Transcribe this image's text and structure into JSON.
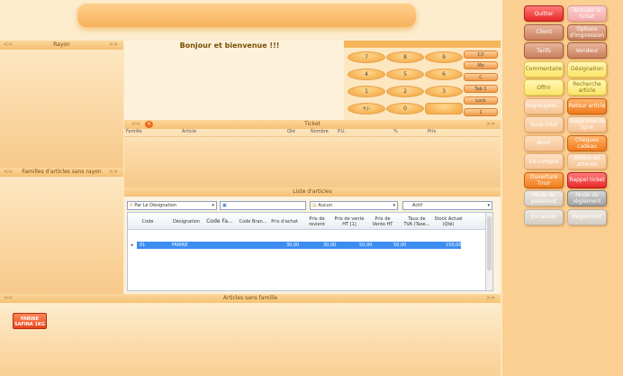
{
  "welcome": "Bonjour et bienvenue !!!",
  "panels": {
    "rayon": "Rayon",
    "familles": "Familles d'articles sans rayon",
    "ticket": "Ticket",
    "liste": "Liste d'articles",
    "articles_sans_famille": "Articles sans famille"
  },
  "nav": {
    "left": "<<",
    "right": ">>"
  },
  "keypad": {
    "rows": [
      [
        "7",
        "8",
        "9"
      ],
      [
        "4",
        "5",
        "6"
      ],
      [
        "1",
        "2",
        "3"
      ],
      [
        "+/-",
        "0",
        ""
      ]
    ],
    "side": [
      "C/I",
      "Mx",
      "C",
      "Tab 1",
      "Lock",
      "1"
    ]
  },
  "ticket_columns": [
    "Famille",
    "Article",
    "Qté",
    "Nombre",
    "P.U.",
    "%",
    "Prix"
  ],
  "search": {
    "filter_value": "Par Le Désignation",
    "search_value": "",
    "scope_value": "Aucun",
    "mode_value": "Actif"
  },
  "grid": {
    "columns": [
      "Code",
      "Désignation",
      "Code Fa...",
      "Code Bran...",
      "Prix d'achat",
      "Prix de revient",
      "Prix de vente HT [1]",
      "Prix de Vente HT",
      "Taux de TVA (Taxe...",
      "Stock Actuel (Qté)"
    ],
    "rows": [
      [
        "01",
        "FARINE",
        "",
        "",
        "30,00",
        "30,00",
        "50,00",
        "50,00",
        "",
        "150,00"
      ]
    ]
  },
  "article_chip": "FARINE SAFINA 1KG",
  "right_buttons": [
    {
      "label": "Quitter",
      "color": "red"
    },
    {
      "label": "Annuler le ticket",
      "color": "pink"
    },
    {
      "label": "Client",
      "color": "brown"
    },
    {
      "label": "Options d'impression",
      "color": "brown"
    },
    {
      "label": "Tarifs",
      "color": "brown"
    },
    {
      "label": "Vendeur",
      "color": "brown"
    },
    {
      "label": "Commentaire",
      "color": "yellow"
    },
    {
      "label": "Désignation",
      "color": "yellow"
    },
    {
      "label": "Offrir",
      "color": "yellow"
    },
    {
      "label": "Recherche article",
      "color": "yellow"
    },
    {
      "label": "Regroupem...",
      "color": "peach"
    },
    {
      "label": "Retour article",
      "color": "orange"
    },
    {
      "label": "Sous-total",
      "color": "peach"
    },
    {
      "label": "Supprimer la ligne",
      "color": "peach"
    },
    {
      "label": "Avoir",
      "color": "peach"
    },
    {
      "label": "Chèques cadeau",
      "color": "orange"
    },
    {
      "label": "En compte",
      "color": "peach"
    },
    {
      "label": "Mettre en attente",
      "color": "peach"
    },
    {
      "label": "Ouverture Tiroir",
      "color": "orange"
    },
    {
      "label": "Rappel ticket",
      "color": "red"
    },
    {
      "label": "Mode de paiement",
      "color": "lgray"
    },
    {
      "label": "Mode de règlement",
      "color": "gray"
    },
    {
      "label": "Encaisser",
      "color": "lgray"
    },
    {
      "label": "Règlement",
      "color": "lgray"
    }
  ]
}
